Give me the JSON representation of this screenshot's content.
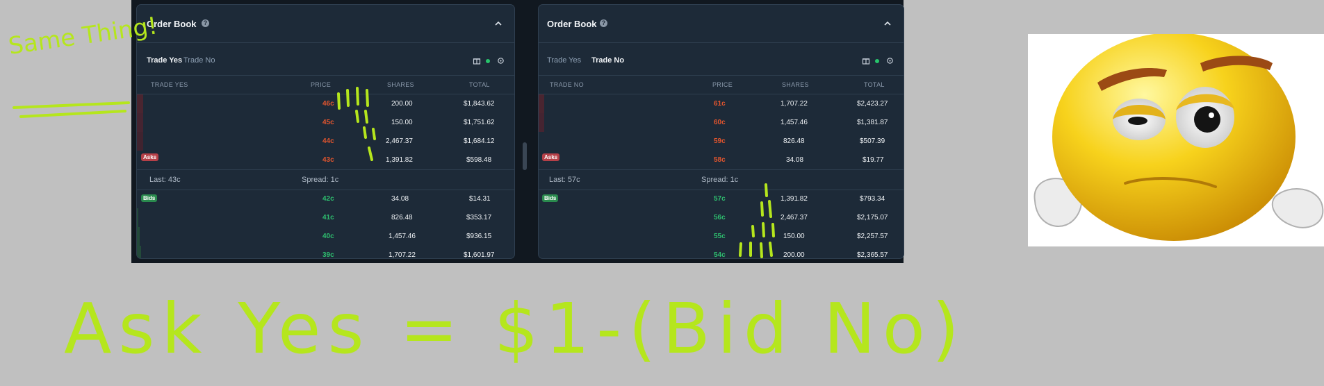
{
  "colors": {
    "ask": "#e2552e",
    "bid": "#2ebd6e",
    "annotation": "#b5e61d"
  },
  "left": {
    "title": "Order Book",
    "tabs": [
      "Trade Yes",
      "Trade No"
    ],
    "active_tab": 0,
    "headers": [
      "TRADE YES",
      "PRICE",
      "SHARES",
      "TOTAL"
    ],
    "asks_label": "Asks",
    "bids_label": "Bids",
    "asks": [
      {
        "price": "46c",
        "shares": "200.00",
        "total": "$1,843.62"
      },
      {
        "price": "45c",
        "shares": "150.00",
        "total": "$1,751.62"
      },
      {
        "price": "44c",
        "shares": "2,467.37",
        "total": "$1,684.12"
      },
      {
        "price": "43c",
        "shares": "1,391.82",
        "total": "$598.48"
      }
    ],
    "last": "Last: 43c",
    "spread": "Spread: 1c",
    "bids": [
      {
        "price": "42c",
        "shares": "34.08",
        "total": "$14.31"
      },
      {
        "price": "41c",
        "shares": "826.48",
        "total": "$353.17"
      },
      {
        "price": "40c",
        "shares": "1,457.46",
        "total": "$936.15"
      },
      {
        "price": "39c",
        "shares": "1,707.22",
        "total": "$1,601.97"
      }
    ]
  },
  "right": {
    "title": "Order Book",
    "tabs": [
      "Trade Yes",
      "Trade No"
    ],
    "active_tab": 1,
    "headers": [
      "TRADE NO",
      "PRICE",
      "SHARES",
      "TOTAL"
    ],
    "asks_label": "Asks",
    "bids_label": "Bids",
    "asks": [
      {
        "price": "61c",
        "shares": "1,707.22",
        "total": "$2,423.27"
      },
      {
        "price": "60c",
        "shares": "1,457.46",
        "total": "$1,381.87"
      },
      {
        "price": "59c",
        "shares": "826.48",
        "total": "$507.39"
      },
      {
        "price": "58c",
        "shares": "34.08",
        "total": "$19.77"
      }
    ],
    "last": "Last: 57c",
    "spread": "Spread: 1c",
    "bids": [
      {
        "price": "57c",
        "shares": "1,391.82",
        "total": "$793.34"
      },
      {
        "price": "56c",
        "shares": "2,467.37",
        "total": "$2,175.07"
      },
      {
        "price": "55c",
        "shares": "150.00",
        "total": "$2,257.57"
      },
      {
        "price": "54c",
        "shares": "200.00",
        "total": "$2,365.57"
      }
    ]
  },
  "annotations": {
    "corner_note": "Same Thing!",
    "formula": "Ask Yes = $1-(Bid No)"
  }
}
